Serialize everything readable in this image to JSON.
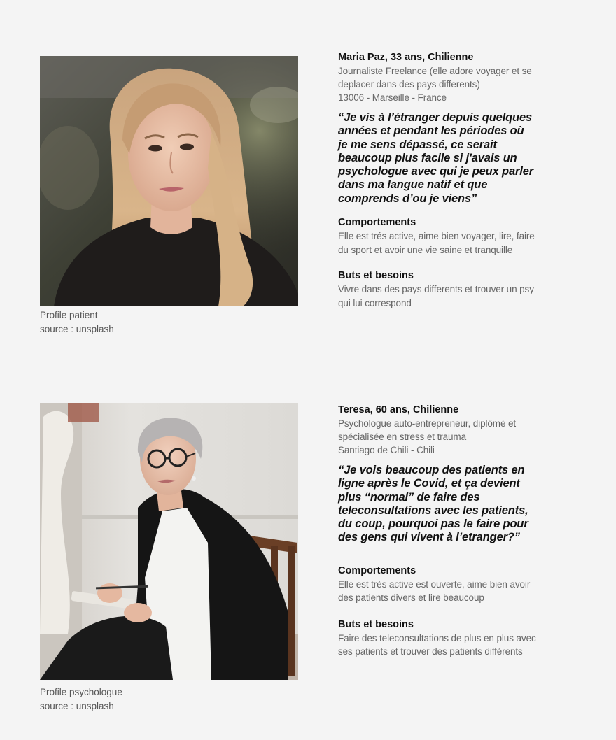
{
  "personas": [
    {
      "name": "Maria Paz,  33 ans, Chilienne",
      "meta": [
        "Journaliste Freelance (elle adore voyager et se",
        "deplacer dans des pays differents)",
        "13006 - Marseille - France"
      ],
      "quote": "“Je vis à l’étranger depuis quelques\nannées et pendant les périodes où\nje me sens dépassé, ce serait\nbeaucoup plus facile si j'avais un\npsychologue avec qui je peux parler\ndans ma langue natif et que\ncomprends d’ou je viens”",
      "comportements_title": "Comportements",
      "comportements_text": "Elle est trés active, aime bien voyager, lire, faire\ndu sport et avoir une vie saine et tranquille",
      "buts_title": "Buts et besoins",
      "buts_text": "Vivre dans des pays differents et trouver un psy\nqui lui correspond",
      "caption_line1": "Profile patient",
      "caption_line2": "source : unsplash"
    },
    {
      "name": "Teresa,  60 ans, Chilienne",
      "meta": [
        "Psychologue auto-entrepreneur, diplômé et",
        "spécialisée en stress et trauma",
        "Santiago de Chili - Chili"
      ],
      "quote": "“Je vois beaucoup des patients en\nligne après le Covid, et ça devient\nplus “normal” de faire des\nteleconsultations avec les patients,\ndu coup, pourquoi pas le faire pour\ndes gens qui vivent à l’etranger?”",
      "comportements_title": "Comportements",
      "comportements_text": "Elle est très active est ouverte, aime bien avoir\ndes patients divers et lire beaucoup",
      "buts_title": "Buts et besoins",
      "buts_text": "Faire des teleconsultations de plus en plus avec\nses patients et trouver des patients différents",
      "caption_line1": "Profile psychologue",
      "caption_line2": "source : unsplash"
    }
  ]
}
